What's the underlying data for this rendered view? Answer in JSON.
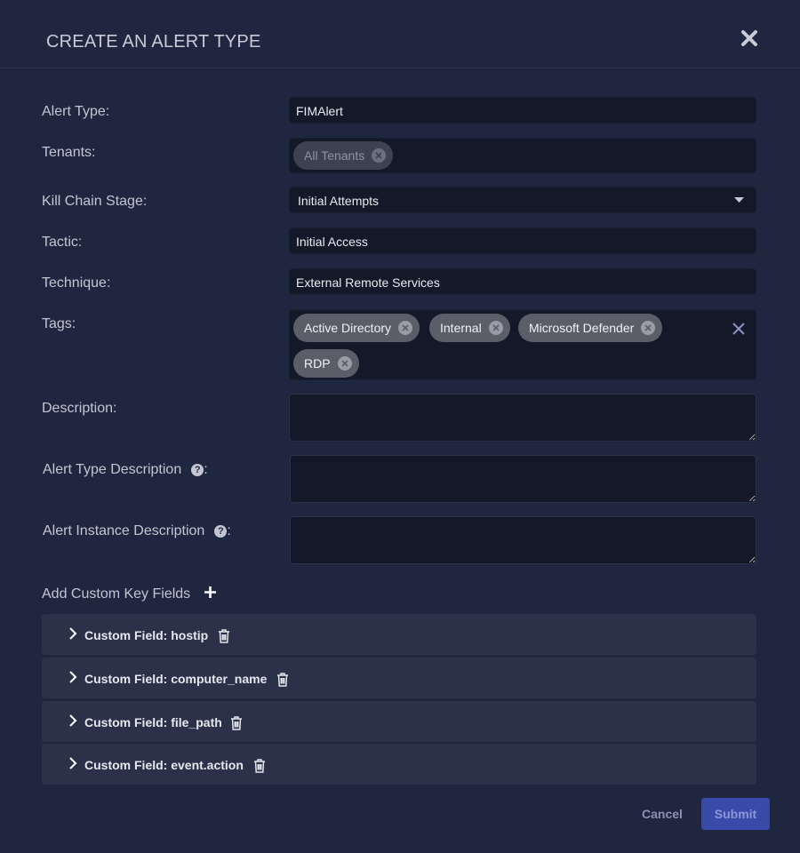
{
  "modal": {
    "title": "CREATE AN ALERT TYPE"
  },
  "form": {
    "alert_type": {
      "label": "Alert Type:",
      "value": "FIMAlert"
    },
    "tenants": {
      "label": "Tenants:",
      "chips": [
        "All Tenants"
      ]
    },
    "kill_chain": {
      "label": "Kill Chain Stage:",
      "value": "Initial Attempts"
    },
    "tactic": {
      "label": "Tactic:",
      "value": "Initial Access"
    },
    "technique": {
      "label": "Technique:",
      "value": "External Remote Services"
    },
    "tags": {
      "label": "Tags:",
      "chips": [
        "Active Directory",
        "Internal",
        "Microsoft Defender",
        "RDP"
      ]
    },
    "description": {
      "label": "Description:"
    },
    "alert_type_description": {
      "label": "Alert Type Description",
      "suffix": ":"
    },
    "alert_instance_description": {
      "label": "Alert Instance Description",
      "suffix": ":"
    }
  },
  "custom_fields": {
    "add_label": "Add Custom Key Fields",
    "items": [
      "Custom Field: hostip",
      "Custom Field: computer_name",
      "Custom Field: file_path",
      "Custom Field: event.action"
    ]
  },
  "footer": {
    "cancel_label": "Cancel",
    "submit_label": "Submit"
  },
  "colors": {
    "background": "#1f2640",
    "field": "#141929",
    "chip": "#5b5e69",
    "submit": "#3a4aa8",
    "accordion": "#2a3149"
  }
}
